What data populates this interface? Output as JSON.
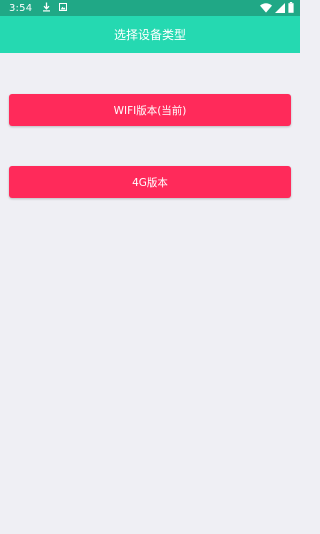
{
  "status_bar": {
    "time": "3:54",
    "left_icons": [
      "download-icon",
      "photo-notification-icon"
    ],
    "right_icons": [
      "wifi-icon",
      "signal-icon",
      "battery-icon"
    ],
    "background": "#20a886"
  },
  "app_bar": {
    "title": "选择设备类型",
    "background": "#25d9b1"
  },
  "options": [
    {
      "label": "WIFI版本(当前)"
    },
    {
      "label": "4G版本"
    }
  ],
  "colors": {
    "button": "#ff2a5a",
    "page_background": "#efeff4"
  }
}
